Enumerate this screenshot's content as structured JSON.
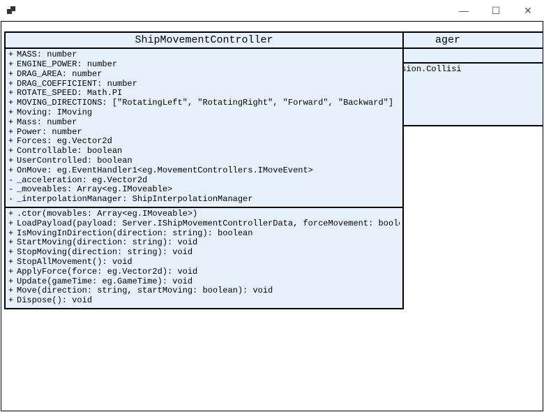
{
  "window": {
    "title": "",
    "controls": {
      "minimize": "—",
      "maximize": "☐",
      "close": "✕"
    }
  },
  "classes": {
    "main": {
      "name": "ShipMovementController",
      "attributes": [
        {
          "vis": "+",
          "text": "MASS: number"
        },
        {
          "vis": "+",
          "text": "ENGINE_POWER: number"
        },
        {
          "vis": "+",
          "text": "DRAG_AREA: number"
        },
        {
          "vis": "+",
          "text": "DRAG_COEFFICIENT: number"
        },
        {
          "vis": "+",
          "text": "ROTATE_SPEED: Math.PI"
        },
        {
          "vis": "+",
          "text": "MOVING_DIRECTIONS: [\"RotatingLeft\", \"RotatingRight\", \"Forward\", \"Backward\"]"
        },
        {
          "vis": "+",
          "text": "Moving: IMoving"
        },
        {
          "vis": "+",
          "text": "Mass: number"
        },
        {
          "vis": "+",
          "text": "Power: number"
        },
        {
          "vis": "+",
          "text": "Forces: eg.Vector2d"
        },
        {
          "vis": "+",
          "text": "Controllable: boolean"
        },
        {
          "vis": "+",
          "text": "UserControlled: boolean"
        },
        {
          "vis": "+",
          "text": "OnMove: eg.EventHandler1<eg.MovementControllers.IMoveEvent>"
        },
        {
          "vis": "-",
          "text": "_acceleration: eg.Vector2d"
        },
        {
          "vis": "-",
          "text": "_moveables: Array<eg.IMoveable>"
        },
        {
          "vis": "-",
          "text": "_interpolationManager: ShipInterpolationManager"
        }
      ],
      "operations": [
        {
          "vis": "+",
          "text": ".ctor(movables: Array<eg.IMoveable>)"
        },
        {
          "vis": "+",
          "text": "LoadPayload(payload: Server.IShipMovementControllerData, forceMovement: boolean): void"
        },
        {
          "vis": "+",
          "text": "IsMovingInDirection(direction: string): boolean"
        },
        {
          "vis": "+",
          "text": "StartMoving(direction: string): void"
        },
        {
          "vis": "+",
          "text": "StopMoving(direction: string): void"
        },
        {
          "vis": "+",
          "text": "StopAllMovement(): void"
        },
        {
          "vis": "+",
          "text": "ApplyForce(force: eg.Vector2d): void"
        },
        {
          "vis": "+",
          "text": "Update(gameTime: eg.GameTime): void"
        },
        {
          "vis": "+",
          "text": "Move(direction: string, startMoving: boolean): void"
        },
        {
          "vis": "+",
          "text": "Dispose(): void"
        }
      ]
    },
    "back": {
      "name_fragment": "ager",
      "attributes": [
        {
          "vis": "",
          "text": ""
        }
      ],
      "operations": [
        {
          "vis": "",
          "text": "anager: eg.Collision.Collisi"
        }
      ]
    }
  }
}
